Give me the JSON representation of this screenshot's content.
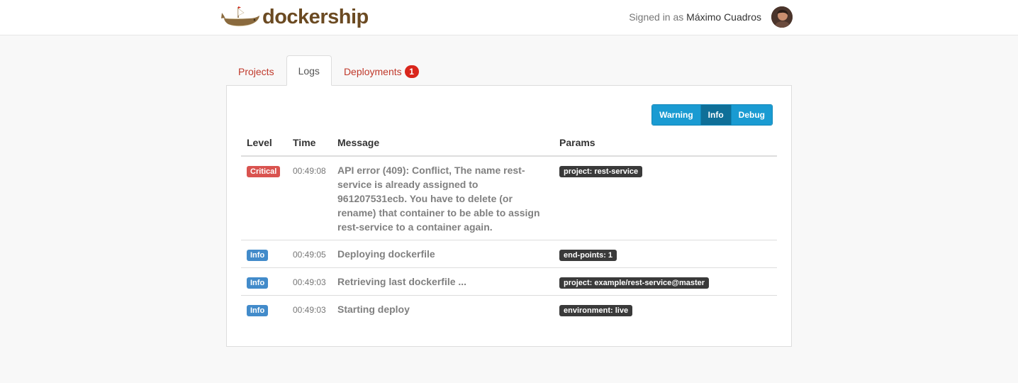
{
  "header": {
    "brand": "dockership",
    "signed_in_prefix": "Signed in as",
    "user_name": "Máximo Cuadros"
  },
  "tabs": [
    {
      "label": "Projects",
      "active": false
    },
    {
      "label": "Logs",
      "active": true
    },
    {
      "label": "Deployments",
      "active": false,
      "badge": "1"
    }
  ],
  "level_filter": {
    "options": [
      "Warning",
      "Info",
      "Debug"
    ],
    "selected": "Info"
  },
  "table": {
    "headers": [
      "Level",
      "Time",
      "Message",
      "Params"
    ],
    "rows": [
      {
        "level": "Critical",
        "time": "00:49:08",
        "message": "API error (409): Conflict, The name rest-service is already assigned to 961207531ecb. You have to delete (or rename) that container to be able to assign rest-service to a container again.",
        "params": [
          "project: rest-service"
        ]
      },
      {
        "level": "Info",
        "time": "00:49:05",
        "message": "Deploying dockerfile",
        "params": [
          "end-points: 1"
        ]
      },
      {
        "level": "Info",
        "time": "00:49:03",
        "message": "Retrieving last dockerfile ...",
        "params": [
          "project: example/rest-service@master"
        ]
      },
      {
        "level": "Info",
        "time": "00:49:03",
        "message": "Starting deploy",
        "params": [
          "environment: live"
        ]
      }
    ]
  },
  "colors": {
    "brand": "#6b4a22",
    "tab_link": "#c0392b",
    "critical": "#d9534f",
    "info": "#428bca",
    "param": "#3a3a3a",
    "filter": "#1a9bd2",
    "filter_active": "#0f6f98"
  }
}
